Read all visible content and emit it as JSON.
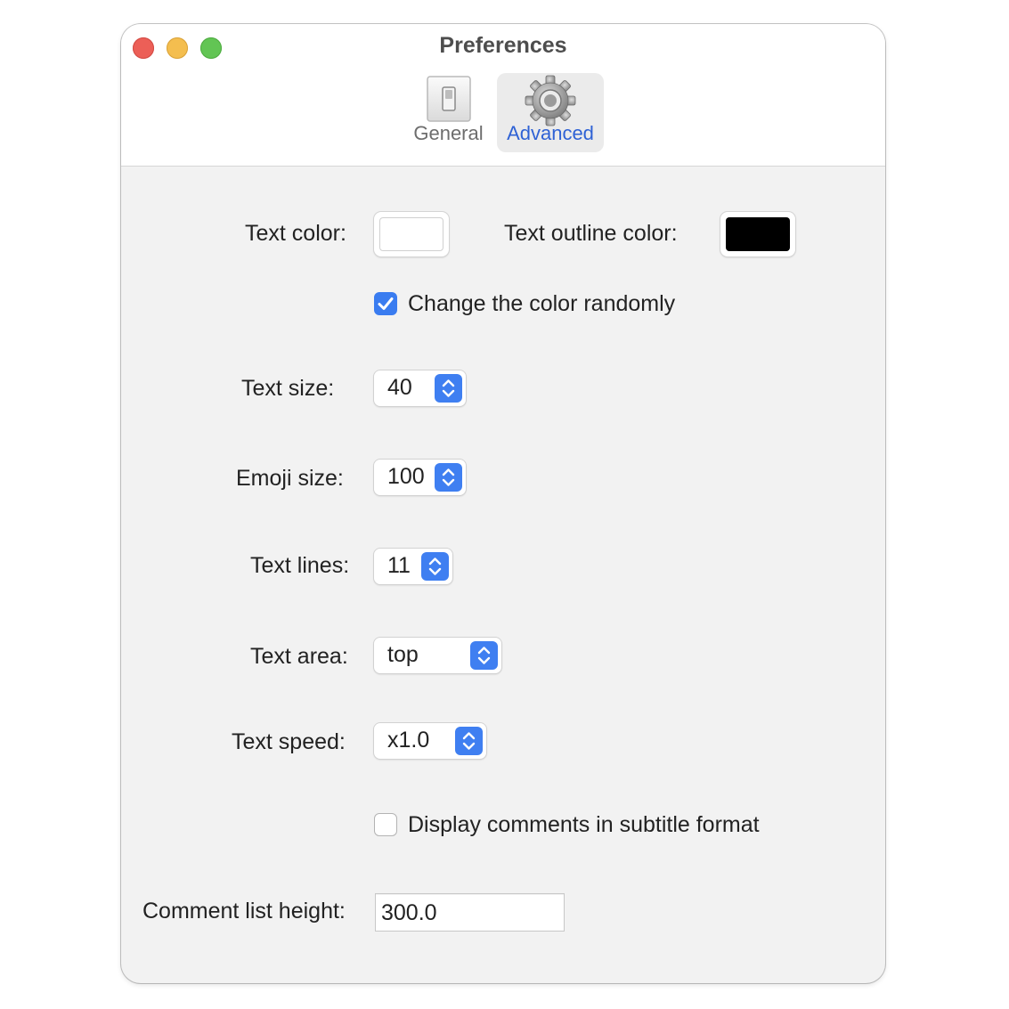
{
  "window": {
    "title": "Preferences"
  },
  "toolbar": {
    "tabs": [
      {
        "label": "General",
        "icon": "switch-icon",
        "selected": false
      },
      {
        "label": "Advanced",
        "icon": "gear-icon",
        "selected": true
      }
    ]
  },
  "settings": {
    "text_color_label": "Text color:",
    "text_color": "#ffffff",
    "text_outline_color_label": "Text outline color:",
    "text_outline_color": "#000000",
    "random_color_label": "Change the color randomly",
    "random_color_checked": true,
    "text_size_label": "Text size:",
    "text_size": "40",
    "emoji_size_label": "Emoji size:",
    "emoji_size": "100",
    "text_lines_label": "Text lines:",
    "text_lines": "11",
    "text_area_label": "Text area:",
    "text_area": "top",
    "text_speed_label": "Text speed:",
    "text_speed": "x1.0",
    "subtitle_format_label": "Display comments in subtitle format",
    "subtitle_format_checked": false,
    "comment_list_height_label": "Comment list height:",
    "comment_list_height": "300.0"
  },
  "colors": {
    "accent": "#3a7cf0",
    "close": "#ec5f57",
    "minimize": "#f4be4f",
    "zoom": "#62c554"
  }
}
